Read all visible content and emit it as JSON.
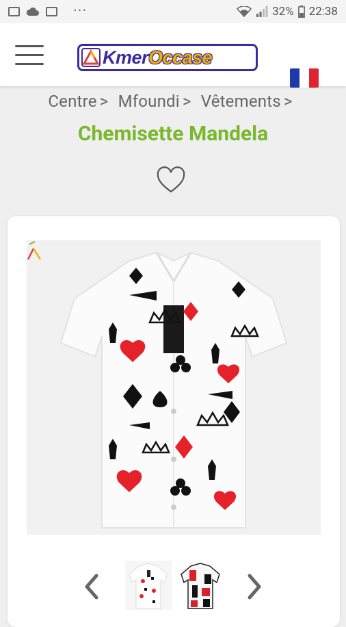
{
  "status_bar": {
    "battery": "32%",
    "time": "22:38",
    "more": "···"
  },
  "header": {
    "logo_part1": "Kmer",
    "logo_part2": "Occase"
  },
  "breadcrumb": {
    "items": [
      "Centre",
      "Mfoundi",
      "Vêtements"
    ],
    "separator": ">"
  },
  "product": {
    "title": "Chemisette Mandela"
  },
  "colors": {
    "title_green": "#79b72b",
    "logo_blue": "#3a2ca0",
    "logo_yellow": "#f2b200"
  }
}
